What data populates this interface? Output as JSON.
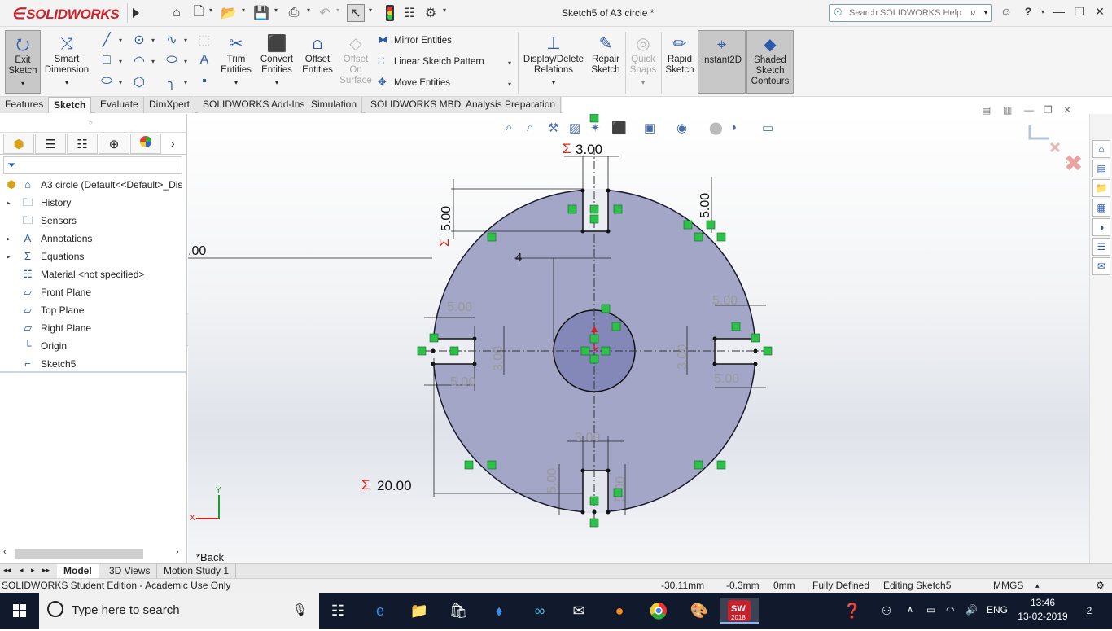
{
  "titlebar": {
    "logo": "SOLIDWORKS",
    "document_title": "Sketch5 of A3 circle *",
    "search_placeholder": "Search SOLIDWORKS Help",
    "help": "?"
  },
  "commands": {
    "exit_sketch": "Exit Sketch",
    "smart_dimension": "Smart Dimension",
    "trim_entities": "Trim Entities",
    "convert_entities": "Convert Entities",
    "offset_entities": "Offset Entities",
    "offset_on_surface": "Offset On Surface",
    "mirror_entities": "Mirror Entities",
    "linear_sketch_pattern": "Linear Sketch Pattern",
    "move_entities": "Move Entities",
    "display_delete_relations": "Display/Delete Relations",
    "repair_sketch": "Repair Sketch",
    "quick_snaps": "Quick Snaps",
    "rapid_sketch": "Rapid Sketch",
    "instant2d": "Instant2D",
    "shaded_sketch_contours": "Shaded Sketch Contours"
  },
  "tabs": [
    "Features",
    "Sketch",
    "Evaluate",
    "DimXpert",
    "SOLIDWORKS Add-Ins",
    "Simulation",
    "SOLIDWORKS MBD",
    "Analysis Preparation"
  ],
  "active_tab": "Sketch",
  "tree": {
    "root": "A3 circle  (Default<<Default>_Dis",
    "items": [
      "History",
      "Sensors",
      "Annotations",
      "Equations",
      "Material <not specified>",
      "Front Plane",
      "Top Plane",
      "Right Plane",
      "Origin",
      "Sketch5"
    ]
  },
  "sketch": {
    "dim_top_width": "3.00",
    "dim_top_left_depth": "5.00",
    "dim_top_right_depth": "5.00",
    "dim_left_edge": ".00",
    "dim_center_radius": "4",
    "dim_left_slot_top": "5.00",
    "dim_left_slot_bottom": "5.00",
    "dim_left_slot_width": "3.00",
    "dim_right_slot_top": "5.00",
    "dim_right_slot_bottom": "5.00",
    "dim_right_slot_width": "3.00",
    "dim_bottom_width": "3.00",
    "dim_bottom_left_depth": "5.00",
    "dim_bottom_right_depth": "5.00",
    "dim_diameter": "20.00",
    "sigma": "Σ",
    "view_label": "*Back",
    "axis_x": "X",
    "axis_y": "Y"
  },
  "bottom_tabs": [
    "Model",
    "3D Views",
    "Motion Study 1"
  ],
  "status": {
    "edition": "SOLIDWORKS Student Edition - Academic Use Only",
    "x": "-30.11mm",
    "y": "-0.3mm",
    "z": "0mm",
    "state": "Fully Defined",
    "editing": "Editing Sketch5",
    "units": "MMGS"
  },
  "taskbar": {
    "search_placeholder": "Type here to search",
    "lang": "ENG",
    "time": "13:46",
    "date": "13-02-2019",
    "notifications": "2",
    "sw_year": "2018"
  },
  "colors": {
    "brand": "#d0202a",
    "sketch_fill": "#9b9fc4",
    "relation_green": "#2ec04a",
    "taskbar": "#101a2c"
  }
}
